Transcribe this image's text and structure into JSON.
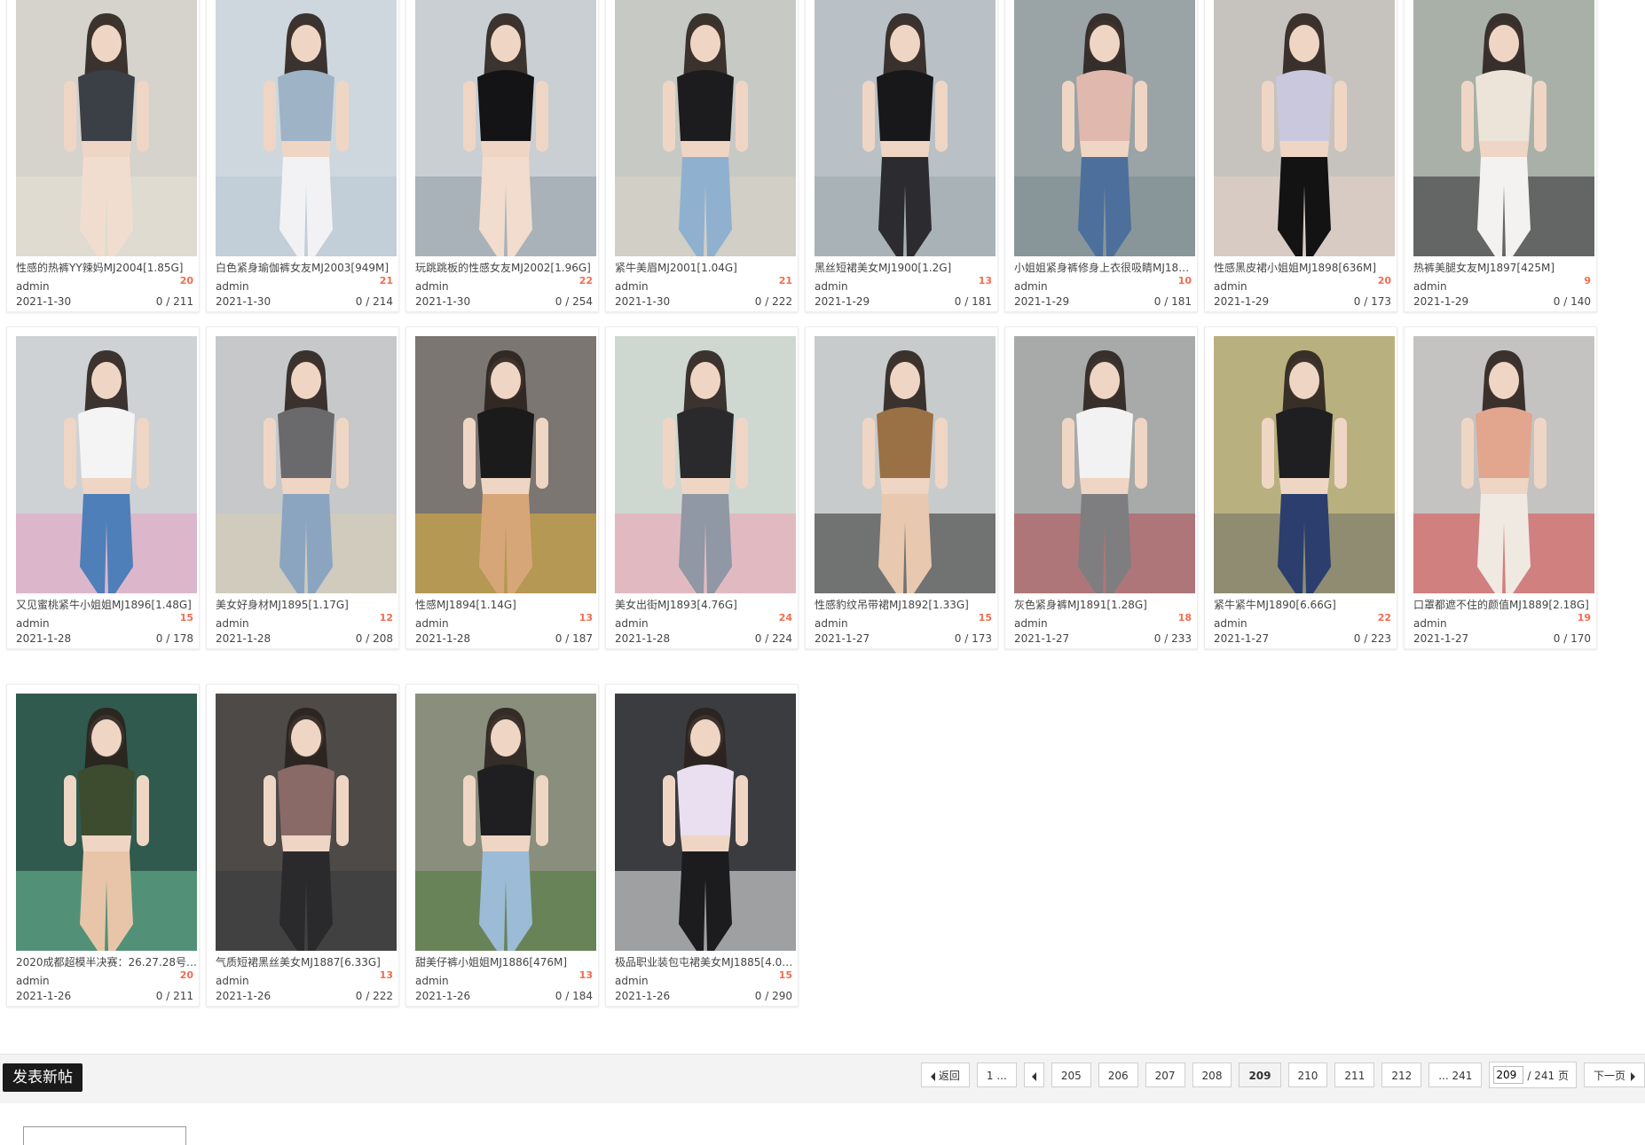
{
  "cards": [
    {
      "title": "性感的热裤YY辣妈MJ2004[1.85G]",
      "author": "admin",
      "replies": "20",
      "date": "2021-1-30",
      "stats": "0 / 211",
      "palette": [
        "#d6d2cc",
        "#3b3f46",
        "#f1ddcf",
        "#e8e2d6"
      ]
    },
    {
      "title": "白色紧身瑜伽裤女友MJ2003[949M]",
      "author": "admin",
      "replies": "21",
      "date": "2021-1-30",
      "stats": "0 / 214",
      "palette": [
        "#cfd7de",
        "#9fb3c6",
        "#f2f2f5",
        "#b8c7d4"
      ]
    },
    {
      "title": "玩跳跳板的性感女友MJ2002[1.96G]",
      "author": "admin",
      "replies": "22",
      "date": "2021-1-30",
      "stats": "0 / 254",
      "palette": [
        "#c9cfd3",
        "#141416",
        "#f1dccd",
        "#8c9aa3"
      ]
    },
    {
      "title": "紧牛美眉MJ2001[1.04G]",
      "author": "admin",
      "replies": "21",
      "date": "2021-1-30",
      "stats": "0 / 222",
      "palette": [
        "#c7c9c4",
        "#1c1c1e",
        "#8fb1cf",
        "#d9d3c8"
      ]
    },
    {
      "title": "黑丝短裙美女MJ1900[1.2G]",
      "author": "admin",
      "replies": "13",
      "date": "2021-1-29",
      "stats": "0 / 181",
      "palette": [
        "#b9c1c6",
        "#18181b",
        "#2b2b30",
        "#9aa6ac"
      ]
    },
    {
      "title": "小姐姐紧身裤修身上衣很吸睛MJ189…",
      "author": "admin",
      "replies": "10",
      "date": "2021-1-29",
      "stats": "0 / 181",
      "palette": [
        "#9aa3a5",
        "#e0b8ad",
        "#4c6f9c",
        "#7c8c8f"
      ]
    },
    {
      "title": "性感黑皮裙小姐姐MJ1898[636M]",
      "author": "admin",
      "replies": "20",
      "date": "2021-1-29",
      "stats": "0 / 173",
      "palette": [
        "#c6c2be",
        "#c9c8dc",
        "#131314",
        "#e5d4c6"
      ]
    },
    {
      "title": "热裤美腿女友MJ1897[425M]",
      "author": "admin",
      "replies": "9",
      "date": "2021-1-29",
      "stats": "0 / 140",
      "palette": [
        "#a9b0a8",
        "#ece4d9",
        "#f4f2f0",
        "#2a2a2c"
      ]
    },
    {
      "title": "又见蜜桃紧牛小姐姐MJ1896[1.48G]",
      "author": "admin",
      "replies": "15",
      "date": "2021-1-28",
      "stats": "0 / 178",
      "palette": [
        "#cfd2d4",
        "#f4f4f4",
        "#4e7fb9",
        "#e7a0c4"
      ]
    },
    {
      "title": "美女好身材MJ1895[1.17G]",
      "author": "admin",
      "replies": "12",
      "date": "2021-1-28",
      "stats": "0 / 208",
      "palette": [
        "#c6c8c9",
        "#6a6a6c",
        "#8ba5c1",
        "#d8cdb3"
      ]
    },
    {
      "title": "性感MJ1894[1.14G]",
      "author": "admin",
      "replies": "13",
      "date": "2021-1-28",
      "stats": "0 / 187",
      "palette": [
        "#7b7671",
        "#1b1b1c",
        "#d7a678",
        "#e3b53c"
      ]
    },
    {
      "title": "美女出街MJ1893[4.76G]",
      "author": "admin",
      "replies": "24",
      "date": "2021-1-28",
      "stats": "0 / 224",
      "palette": [
        "#cfd7d1",
        "#2a2a2c",
        "#8f98a4",
        "#f0a3b5"
      ]
    },
    {
      "title": "性感豹纹吊带裙MJ1892[1.33G]",
      "author": "admin",
      "replies": "15",
      "date": "2021-1-27",
      "stats": "0 / 173",
      "palette": [
        "#c8cbcb",
        "#9a7045",
        "#e8c8ae",
        "#2a2a2a"
      ]
    },
    {
      "title": "灰色紧身裤MJ1891[1.28G]",
      "author": "admin",
      "replies": "18",
      "date": "2021-1-27",
      "stats": "0 / 233",
      "palette": [
        "#a7aaa8",
        "#f2f2f2",
        "#7e7e80",
        "#b54a52"
      ]
    },
    {
      "title": "紧牛紧牛MJ1890[6.66G]",
      "author": "admin",
      "replies": "22",
      "date": "2021-1-27",
      "stats": "0 / 223",
      "palette": [
        "#b9b07f",
        "#1f1f22",
        "#2b3e6e",
        "#6f7068"
      ]
    },
    {
      "title": "口罩都遮不住的颜值MJ1889[2.18G]",
      "author": "admin",
      "replies": "19",
      "date": "2021-1-27",
      "stats": "0 / 170",
      "palette": [
        "#c5c3c1",
        "#e2a58e",
        "#f0e9e2",
        "#d84848"
      ]
    },
    {
      "title": "2020成都超模半决赛：26.27.28号…",
      "author": "admin",
      "replies": "20",
      "date": "2021-1-26",
      "stats": "0 / 211",
      "palette": [
        "#2f5a4d",
        "#3d4b2e",
        "#e8c5a8",
        "#6fbf9c"
      ]
    },
    {
      "title": "气质短裙黑丝美女MJ1887[6.33G]",
      "author": "admin",
      "replies": "13",
      "date": "2021-1-26",
      "stats": "0 / 222",
      "palette": [
        "#4d4a48",
        "#8a6a66",
        "#2a2a2c",
        "#3a3a3c"
      ]
    },
    {
      "title": "甜美仔裤小姐姐MJ1886[476M]",
      "author": "admin",
      "replies": "13",
      "date": "2021-1-26",
      "stats": "0 / 184",
      "palette": [
        "#8a8e7c",
        "#1f1f21",
        "#9cbbd7",
        "#4d7a3b"
      ]
    },
    {
      "title": "极品职业装包屯裙美女MJ1885[4.01…",
      "author": "admin",
      "replies": "15",
      "date": "2021-1-26",
      "stats": "0 / 290",
      "palette": [
        "#3b3c3f",
        "#eadff0",
        "#1c1c1e",
        "#f2f2f2"
      ]
    }
  ],
  "toolbar": {
    "new_post_label": "发表新帖",
    "back_label": "返回",
    "first_page_label": "1 ...",
    "pages": [
      "205",
      "206",
      "207",
      "208",
      "209",
      "210",
      "211",
      "212"
    ],
    "current_page": "209",
    "last_page_label": "... 241",
    "jump_value": "209",
    "jump_total": "/ 241 页",
    "next_label": "下一页"
  },
  "colors": {
    "reply_count": "#f26c4f",
    "new_post_bg": "#1a1a1a",
    "bar_bg": "#f3f3f3"
  }
}
